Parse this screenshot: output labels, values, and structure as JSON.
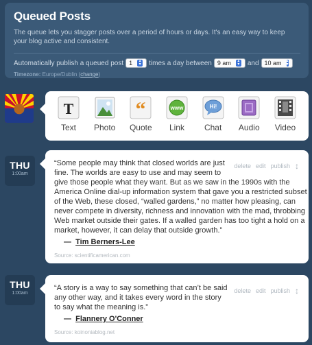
{
  "queue": {
    "title": "Queued Posts",
    "description": "The queue lets you stagger posts over a period of hours or days. It's an easy way to keep your blog active and consistent.",
    "settings": {
      "text1": "Automatically publish a queued post",
      "count_value": "1",
      "text2": "times a day between",
      "start_value": "9 am",
      "text3": "and",
      "end_value": "10 am"
    },
    "timezone_label": "Timezone:",
    "timezone_value": "Europe/Dublin",
    "timezone_change": "change"
  },
  "post_types": [
    {
      "label": "Text",
      "icon": "text-icon"
    },
    {
      "label": "Photo",
      "icon": "photo-icon"
    },
    {
      "label": "Quote",
      "icon": "quote-icon"
    },
    {
      "label": "Link",
      "icon": "link-icon"
    },
    {
      "label": "Chat",
      "icon": "chat-icon"
    },
    {
      "label": "Audio",
      "icon": "audio-icon"
    },
    {
      "label": "Video",
      "icon": "video-icon"
    }
  ],
  "posts": [
    {
      "day": "THU",
      "time": "1:00am",
      "controls": {
        "delete": "delete",
        "edit": "edit",
        "publish": "publish"
      },
      "quote_lines": [
        "“Some people may think that closed worlds are just",
        "fine. The worlds are easy to use and may seem to",
        "give those people what they want. But as we saw in the 1990s with the",
        "America Online dial-up information system that gave you a restricted subset",
        "of the Web, these closed, “walled gardens,” no matter how pleasing, can",
        "never compete in diversity, richness and innovation with the mad, throbbing",
        "Web market outside their gates. If a walled garden has too tight a hold on a",
        "market, however, it can delay that outside growth.”"
      ],
      "attribution_dash": "—",
      "attribution": "Tim Berners-Lee",
      "source": "Source: scientificamerican.com"
    },
    {
      "day": "THU",
      "time": "1:00am",
      "controls": {
        "delete": "delete",
        "edit": "edit",
        "publish": "publish"
      },
      "quote_lines": [
        "“A story is a way to say something that can’t be said",
        "any other way, and it takes every word in the story",
        "to say what the meaning is.”"
      ],
      "attribution_dash": "—",
      "attribution": "Flannery O'Conner",
      "source": "Source: koinoniablog.net"
    }
  ],
  "colors": {
    "background": "#2c4762",
    "panel": "#3b5a78",
    "date_badge": "#243c54"
  }
}
